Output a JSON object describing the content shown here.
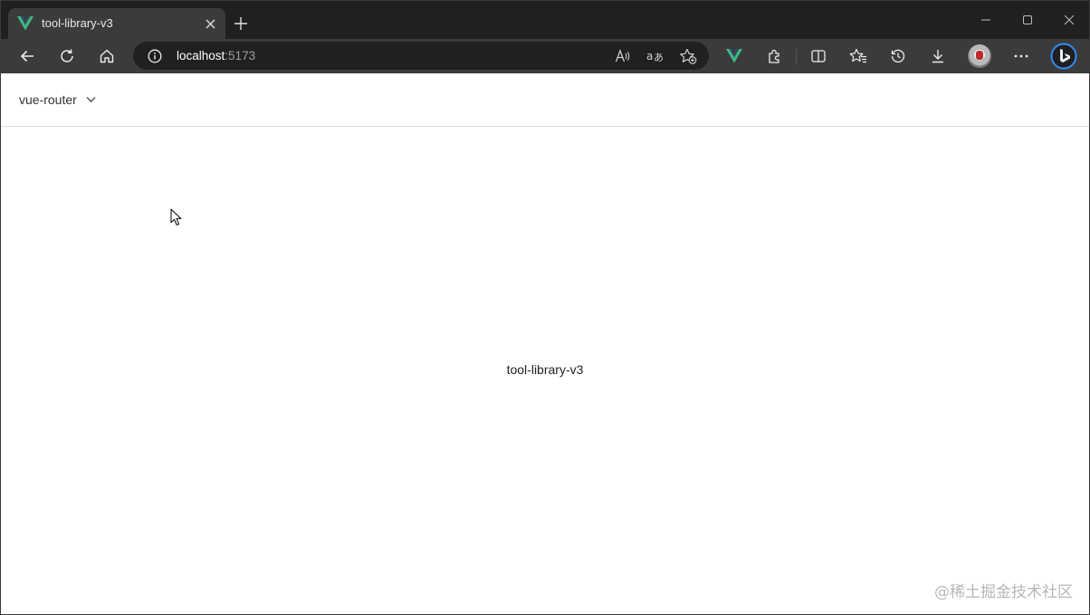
{
  "browser": {
    "tab": {
      "title": "tool-library-v3",
      "favicon": "vue-logo-icon"
    },
    "address_bar": {
      "host": "localhost",
      "port": ":5173"
    },
    "toolbar_icons": [
      "back-icon",
      "refresh-icon",
      "home-icon",
      "info-icon",
      "read-aloud-icon",
      "translate-icon",
      "add-favorite-icon",
      "vue-devtools-icon",
      "extensions-icon",
      "split-screen-icon",
      "favorites-icon",
      "history-icon",
      "downloads-icon",
      "profile-avatar",
      "more-icon",
      "bing-icon"
    ],
    "window_controls": [
      "minimize-icon",
      "maximize-icon",
      "close-icon"
    ]
  },
  "page": {
    "nav": {
      "menu_label": "vue-router"
    },
    "center_text": "tool-library-v3",
    "watermark": "@稀土掘金技术社区"
  },
  "colors": {
    "tab_strip": "#202020",
    "toolbar": "#3b3b3b",
    "vue_green": "#41b883",
    "vue_dark": "#35495e",
    "bing_blue": "#1a73e8"
  }
}
